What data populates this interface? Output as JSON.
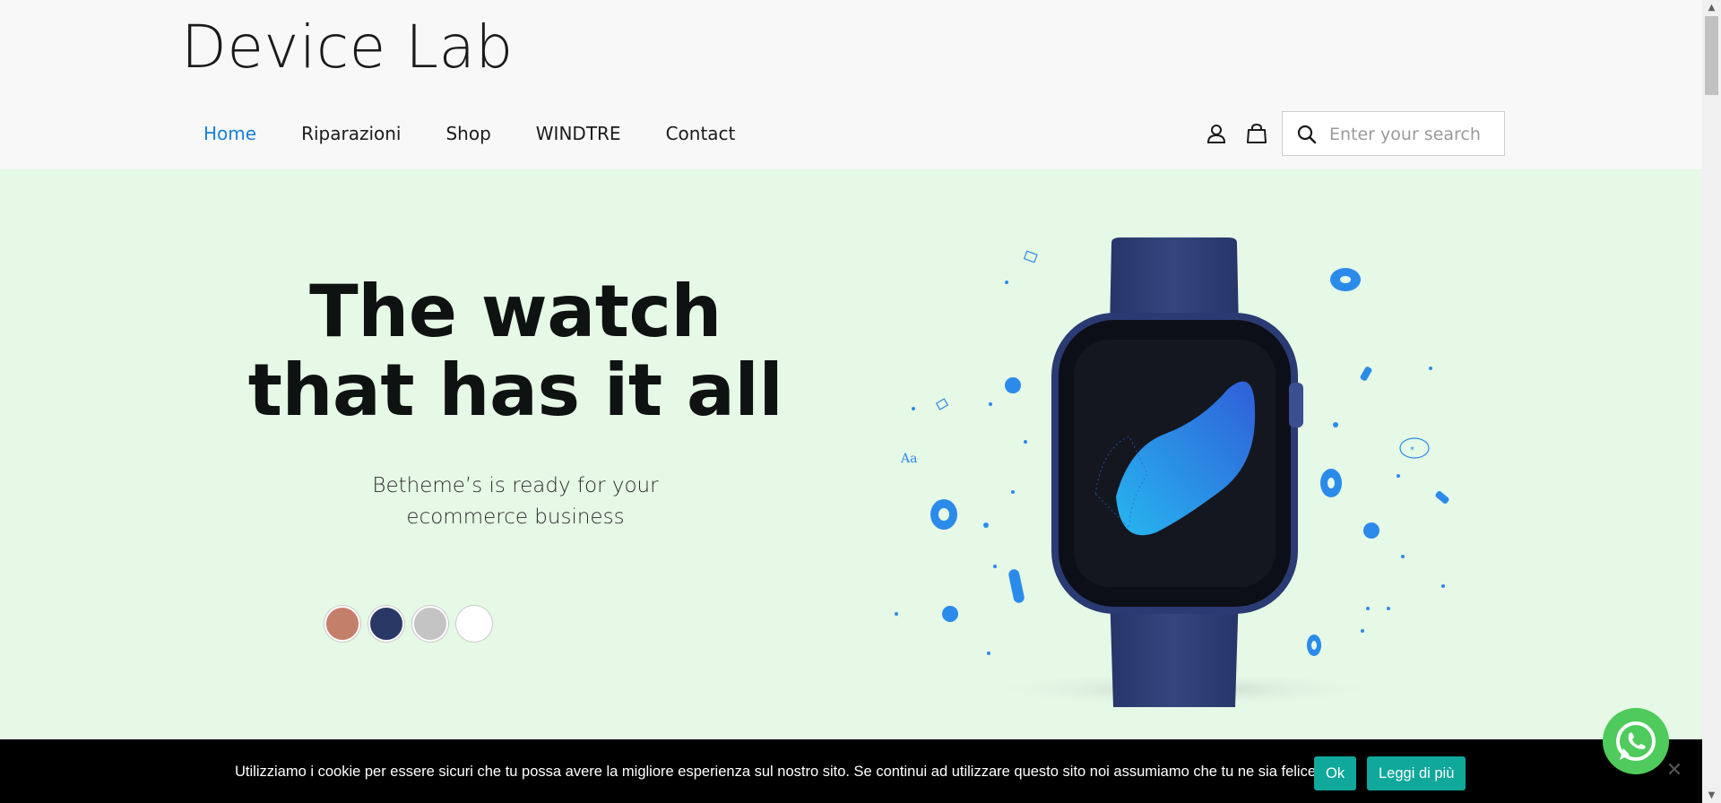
{
  "header": {
    "logo": "Device Lab",
    "nav": [
      {
        "label": "Home",
        "active": true
      },
      {
        "label": "Riparazioni"
      },
      {
        "label": "Shop"
      },
      {
        "label": "WINDTRE"
      },
      {
        "label": "Contact"
      }
    ],
    "icons": [
      "user-icon",
      "bag-icon",
      "search-icon"
    ],
    "search_placeholder": "Enter your search"
  },
  "hero": {
    "title_line1": "The watch",
    "title_line2": "that has it all",
    "subtitle_line1": "Betheme’s is ready for your",
    "subtitle_line2": "ecommerce business",
    "swatches": [
      "#c47f6b",
      "#2a3866",
      "#c4c4c4",
      "#ffffff"
    ],
    "background": "#e6f8e6"
  },
  "cookie": {
    "message": "Utilizziamo i cookie per essere sicuri che tu possa avere la migliore esperienza sul nostro sito. Se continui ad utilizzare questo sito noi assumiamo che tu ne sia felice.",
    "ok_label": "Ok",
    "more_label": "Leggi di più",
    "close_label": "✕",
    "button_color": "#0fa89a"
  },
  "accent_color": "#1a7fd6"
}
